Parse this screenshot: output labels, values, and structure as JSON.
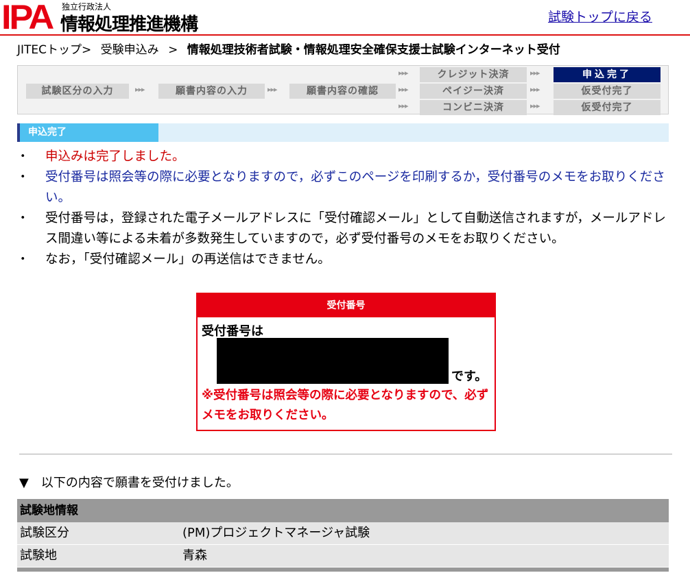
{
  "header": {
    "logo_ipa": "IPA",
    "logo_sub": "独立行政法人",
    "logo_main": "情報処理推進機構",
    "back_link": "試験トップに戻る"
  },
  "breadcrumb": {
    "items": [
      "JITECトップ>",
      "受験申込み",
      ">"
    ],
    "current": "情報処理技術者試験・情報処理安全確保支援士試験インターネット受付"
  },
  "steps": {
    "step1": "試験区分の入力",
    "step2": "願書内容の入力",
    "step3": "願書内容の確認",
    "pay_credit": "クレジット決済",
    "pay_pay_easy": "ペイジー決済",
    "pay_convenience": "コンビニ決済",
    "done_credit": "申込完了",
    "done_pay_easy": "仮受付完了",
    "done_convenience": "仮受付完了",
    "arrow": "▸▸▸"
  },
  "section": {
    "label": "申込完了"
  },
  "notices": {
    "n1": "申込みは完了しました。",
    "n2": "受付番号は照会等の際に必要となりますので，必ずこのページを印刷するか，受付番号のメモをお取りください。",
    "n3": "受付番号は，登録された電子メールアドレスに「受付確認メール」として自動送信されますが，メールアドレス間違い等による未着が多数発生していますので，必ず受付番号のメモをお取りください。",
    "n4": "なお，「受付確認メール」の再送信はできません。"
  },
  "receipt": {
    "title": "受付番号",
    "label": "受付番号は",
    "suffix": "です。",
    "note": "※受付番号は照会等の際に必要となりますので、必ずメモをお取りください。"
  },
  "accepted": {
    "marker": "▼",
    "text": "以下の内容で願書を受付けました。"
  },
  "info_table": {
    "heading": "試験地情報",
    "rows": [
      {
        "key": "試験区分",
        "value": "(PM)プロジェクトマネージャ試験"
      },
      {
        "key": "試験地",
        "value": "青森"
      }
    ]
  },
  "colors": {
    "brand_red": "#e60012",
    "active_step": "#00196e",
    "section_blue": "#4fc1f0",
    "link_blue": "#1a0dab"
  }
}
